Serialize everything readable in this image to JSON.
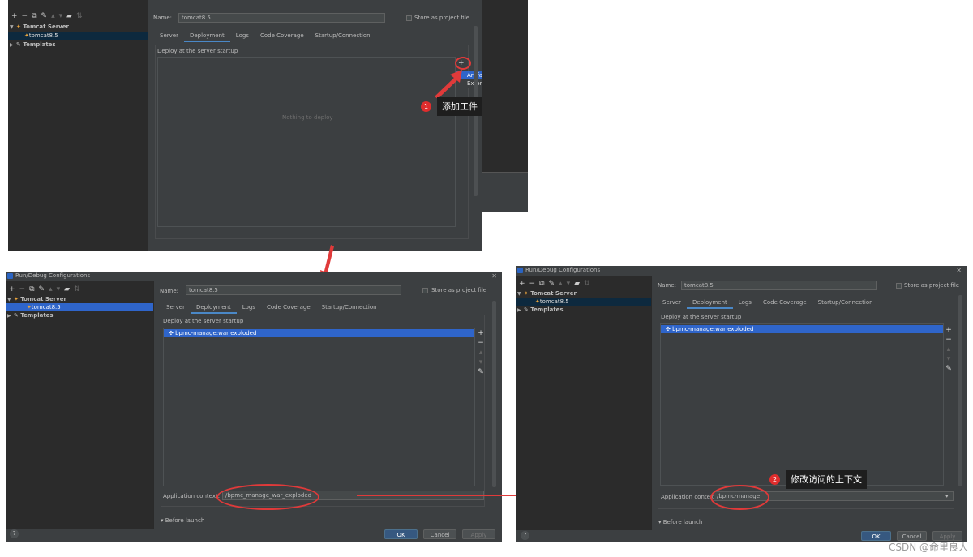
{
  "window_title": "Run/Debug Configurations",
  "toolbar_icons": [
    "add-icon",
    "remove-icon",
    "copy-icon",
    "wrench-icon",
    "move-up-icon",
    "move-down-icon",
    "folder-icon",
    "sort-icon"
  ],
  "toolbar_glyphs": [
    "+",
    "−",
    "⧉",
    "✎",
    "▴",
    "▾",
    "▰",
    "⇅"
  ],
  "tree": {
    "tomcat_server": "Tomcat Server",
    "tomcat_config": "tomcat8.5",
    "templates": "Templates"
  },
  "form": {
    "name_label": "Name:",
    "name_value": "tomcat8.5",
    "store_label": "Store as project file",
    "tabs": [
      "Server",
      "Deployment",
      "Logs",
      "Code Coverage",
      "Startup/Connection"
    ],
    "deploy_heading": "Deploy at the server startup",
    "nothing_to_deploy": "Nothing to deploy",
    "artifact_menu": [
      "Artifact...",
      "External Source..."
    ],
    "deploy_item": "bpmc-manage:war exploded",
    "app_context_label": "Application context:",
    "app_context_value_1": "/bpmc_manage_war_exploded",
    "app_context_value_2": "/bpmc-manage",
    "before_launch": "Before launch",
    "ok": "OK",
    "cancel": "Cancel",
    "apply": "Apply",
    "help": "?"
  },
  "annotations": {
    "step1_number": "1",
    "step1_text": "添加工件",
    "step2_number": "2",
    "step2_text": "修改访问的上下文"
  },
  "watermark": "CSDN @命里良人",
  "colors": {
    "dialog_bg": "#3c3f41",
    "tree_bg": "#2b2b2b",
    "selection": "#2f65ca",
    "annotation_red": "#e03a3a"
  }
}
